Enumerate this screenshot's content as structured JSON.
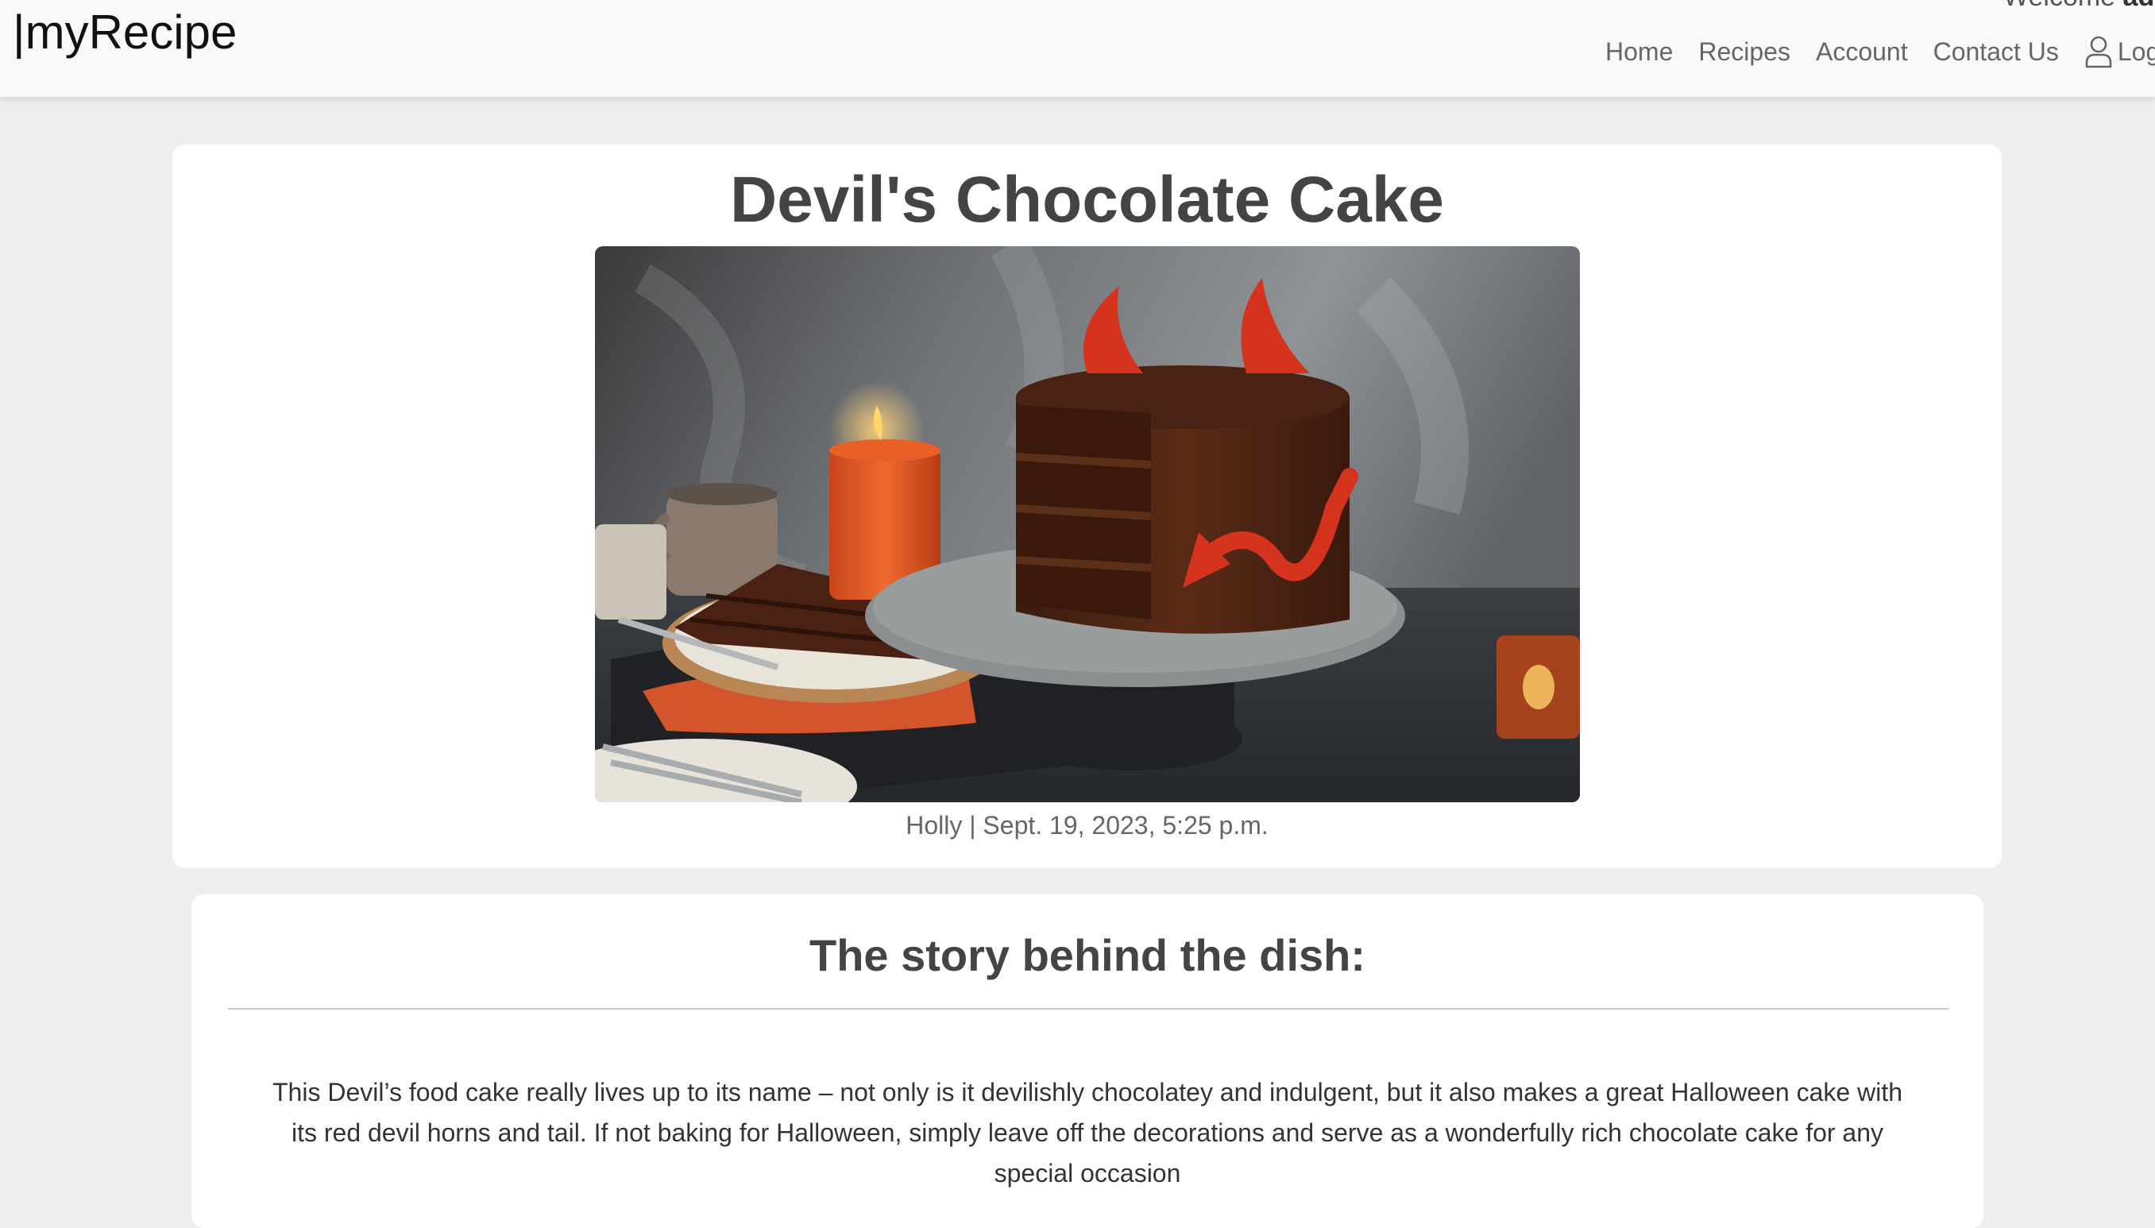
{
  "brand": {
    "name": "|myRecipe"
  },
  "header": {
    "welcome_prefix": "Welcome ",
    "welcome_user": "adm"
  },
  "nav": {
    "items": [
      {
        "label": "Home"
      },
      {
        "label": "Recipes"
      },
      {
        "label": "Account"
      },
      {
        "label": "Contact Us"
      }
    ],
    "login_label": "Log",
    "login_icon": "user-icon"
  },
  "recipe": {
    "title": "Devil's Chocolate Cake",
    "author": "Holly",
    "separator": " | ",
    "date": "Sept. 19, 2023, 5:25 p.m."
  },
  "story": {
    "heading": "The story behind the dish:",
    "body": "This Devil’s food cake really lives up to its name – not only is it devilishly chocolatey and indulgent, but it also makes a great Halloween cake with its red devil horns and tail. If not baking for Halloween, simply leave off the decorations and serve as a wonderfully rich chocolate cake for any special occasion"
  },
  "colors": {
    "page_bg": "#efefef",
    "navbar_bg": "#f9f9f9",
    "card_bg": "#ffffff",
    "heading_text": "#444444",
    "nav_text": "#666666"
  }
}
